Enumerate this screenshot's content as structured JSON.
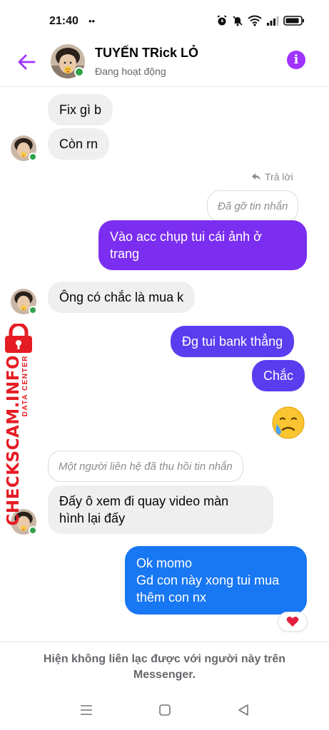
{
  "status_bar": {
    "time": "21:40",
    "indicator": "••"
  },
  "header": {
    "name": "TUYẾN TRick LỎ",
    "status": "Đang hoạt động",
    "icons": {
      "back": "back-arrow-icon",
      "info": "info-icon"
    },
    "accent_color": "#a033ff"
  },
  "messages": [
    {
      "side": "in",
      "text": "Fix gì b"
    },
    {
      "side": "in",
      "text": "Còn rn"
    },
    {
      "side": "meta",
      "text": "Trả lời"
    },
    {
      "side": "out-removed",
      "text": "Đã gỡ tin nhắn"
    },
    {
      "side": "out",
      "lines": [
        "Vào acc chụp tui cái ảnh ở",
        "trang"
      ]
    },
    {
      "side": "in",
      "text": "Ông có chắc là mua k"
    },
    {
      "side": "out",
      "text": "Đg tui bank thẳng"
    },
    {
      "side": "out",
      "text": "Chắc"
    },
    {
      "side": "out-emoji",
      "emoji": "sad-relieved-face-icon"
    },
    {
      "side": "in-removed",
      "text": "Một người liên hệ đã thu hồi tin nhắn"
    },
    {
      "side": "in",
      "lines": [
        "Đấy ô xem đi quay video màn",
        "hình lại đấy"
      ]
    },
    {
      "side": "out",
      "lines": [
        "Ok momo",
        "Gd con này xong tui mua",
        "thêm con nx"
      ],
      "reaction": "heart-icon"
    }
  ],
  "watermark": {
    "main": "CHECKSCAM.INFO",
    "sub": "DATA CENTER"
  },
  "footer": {
    "line1": "Hiện không liên lạc được với người này trên",
    "line2": "Messenger."
  },
  "navbar": {
    "icons": [
      "menu-icon",
      "home-icon",
      "back-icon"
    ]
  },
  "colors": {
    "bubble_in": "#efefef",
    "bubble_out_top": "#7b2ef0",
    "bubble_out_mid": "#5b3df0",
    "bubble_out_bottom": "#1877f2",
    "online": "#31a24c",
    "watermark": "#e51c23"
  }
}
